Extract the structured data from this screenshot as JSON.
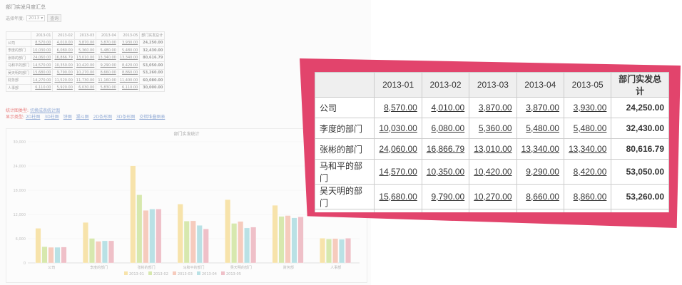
{
  "report_title": "部门实发月度汇总",
  "year_filter": {
    "label": "选择年度:",
    "value": "2013",
    "query_button": "查询"
  },
  "table": {
    "columns": [
      "",
      "2013-01",
      "2013-02",
      "2013-03",
      "2013-04",
      "2013-05",
      "部门实发总计"
    ],
    "rows": [
      {
        "dept": "公司",
        "values": [
          "8,570.00",
          "4,010.00",
          "3,870.00",
          "3,870.00",
          "3,930.00"
        ],
        "total": "24,250.00"
      },
      {
        "dept": "李度的部门",
        "values": [
          "10,030.00",
          "6,080.00",
          "5,360.00",
          "5,480.00",
          "5,480.00"
        ],
        "total": "32,430.00"
      },
      {
        "dept": "张彬的部门",
        "values": [
          "24,060.00",
          "16,866.79",
          "13,010.00",
          "13,340.00",
          "13,340.00"
        ],
        "total": "80,616.79"
      },
      {
        "dept": "马和平的部门",
        "values": [
          "14,570.00",
          "10,350.00",
          "10,420.00",
          "9,290.00",
          "8,420.00"
        ],
        "total": "53,050.00"
      },
      {
        "dept": "吴天明的部门",
        "values": [
          "15,680.00",
          "9,790.00",
          "10,270.00",
          "8,660.00",
          "8,860.00"
        ],
        "total": "53,260.00"
      },
      {
        "dept": "财务部",
        "values": [
          "14,270.00",
          "11,520.00",
          "11,730.00",
          "11,160.00",
          "11,400.00"
        ],
        "total": "60,080.00"
      },
      {
        "dept": "人事部",
        "values": [
          "6,110.00",
          "5,920.00",
          "6,030.00",
          "5,830.00",
          "6,110.00"
        ],
        "total": "30,000.00"
      }
    ]
  },
  "stat_controls": {
    "stat_label": "统计图类型:",
    "stat_link": "切换成表统计图",
    "display_label": "显示类型:",
    "display_options": [
      "2D柱图",
      "3D柱图",
      "饼图",
      "漏斗图",
      "2D条形图",
      "3D条形图",
      "交错堆叠图表"
    ]
  },
  "chart_data": {
    "type": "bar",
    "title": "部门实发统计",
    "categories": [
      "公司",
      "李度的部门",
      "张彬的部门",
      "马和平的部门",
      "吴天明的部门",
      "财务部",
      "人事部"
    ],
    "series": [
      {
        "name": "2013-01",
        "values": [
          8570,
          10030,
          24060,
          14570,
          15680,
          14270,
          6110
        ]
      },
      {
        "name": "2013-02",
        "values": [
          4010,
          6080,
          16866.79,
          10350,
          9790,
          11520,
          5920
        ]
      },
      {
        "name": "2013-03",
        "values": [
          3870,
          5360,
          13010,
          10420,
          10270,
          11730,
          6030
        ]
      },
      {
        "name": "2013-04",
        "values": [
          3870,
          5480,
          13340,
          9290,
          8660,
          11160,
          5830
        ]
      },
      {
        "name": "2013-05",
        "values": [
          3930,
          5480,
          13340,
          8420,
          8860,
          11400,
          6110
        ]
      }
    ],
    "yticks": [
      "0",
      "6,000",
      "12,000",
      "18,000",
      "24,000",
      "30,000"
    ],
    "ylim": [
      0,
      30000
    ],
    "colors": [
      "#f5d98b",
      "#c9e08f",
      "#f3b8a5",
      "#9fd6dc",
      "#e9a8b4"
    ],
    "legend_position": "bottom",
    "grid": true
  },
  "colors": {
    "highlight_border": "#e2446c"
  }
}
